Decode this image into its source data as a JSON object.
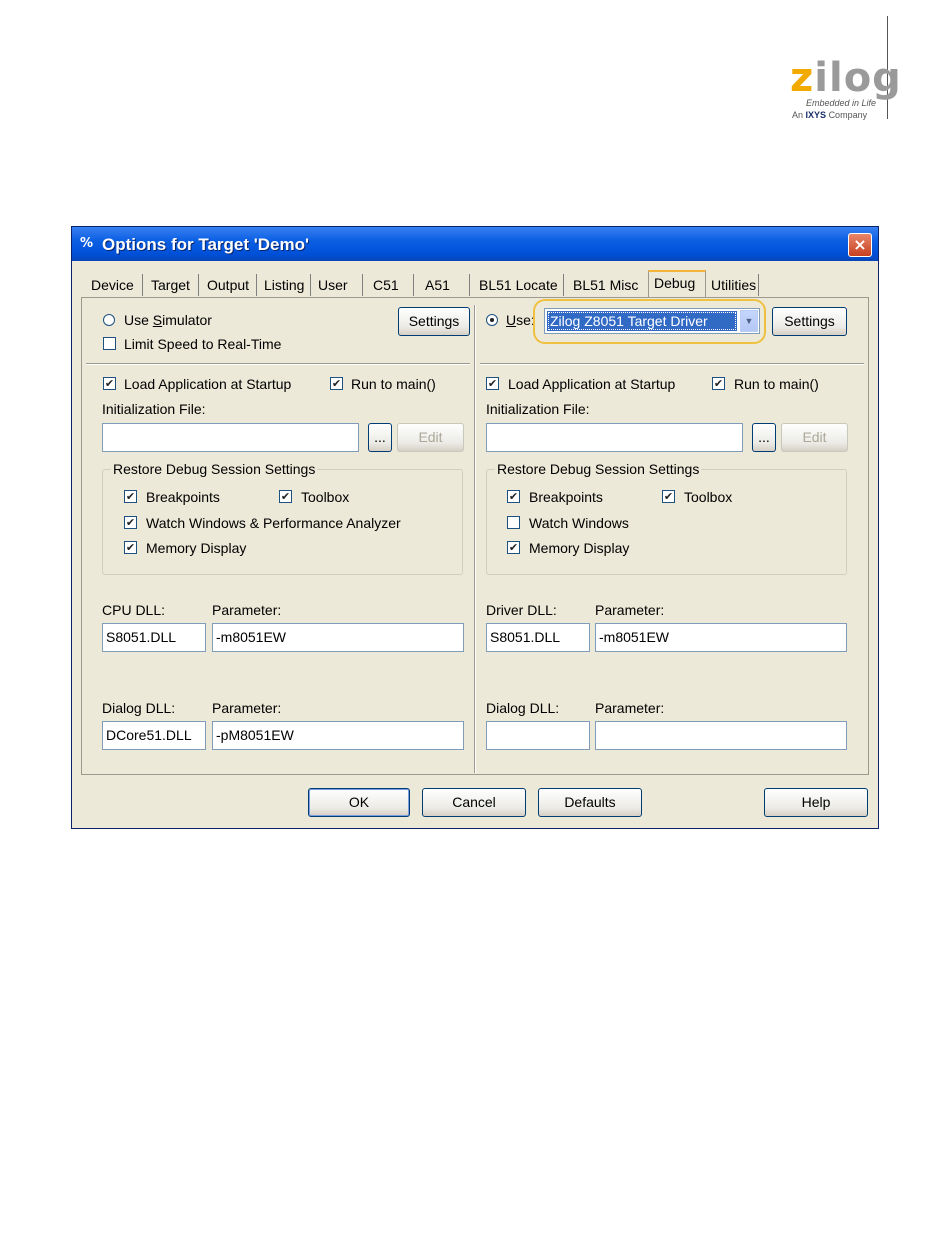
{
  "logo": {
    "brand_z": "z",
    "brand_rest": "ilog",
    "tagline": "Embedded in Life",
    "company_prefix": "An",
    "company_name": "IXYS",
    "company_suffix": "Company"
  },
  "dialog": {
    "title": "Options for Target 'Demo'",
    "close_label": "×",
    "tabs": [
      "Device",
      "Target",
      "Output",
      "Listing",
      "User",
      "C51",
      "A51",
      "BL51 Locate",
      "BL51 Misc",
      "Debug",
      "Utilities"
    ],
    "active_tab": "Debug",
    "left": {
      "use_simulator_pre": "Use ",
      "use_simulator_key": "S",
      "use_simulator_post": "imulator",
      "limit_speed": "Limit Speed to Real-Time",
      "settings": "Settings",
      "load_app": "Load Application at Startup",
      "run_to_main": "Run to main()",
      "init_file_label": "Initialization File:",
      "init_file_value": "",
      "browse": "...",
      "edit": "Edit",
      "restore_group": "Restore Debug Session Settings",
      "breakpoints": "Breakpoints",
      "toolbox": "Toolbox",
      "watch": "Watch Windows & Performance Analyzer",
      "memory": "Memory Display",
      "cpu_dll_label": "CPU DLL:",
      "cpu_param_label": "Parameter:",
      "cpu_dll": "S8051.DLL",
      "cpu_param": "-m8051EW",
      "dialog_dll_label": "Dialog DLL:",
      "dialog_param_label": "Parameter:",
      "dialog_dll": "DCore51.DLL",
      "dialog_param": "-pM8051EW"
    },
    "right": {
      "use_pre": "U",
      "use_post": "se:",
      "driver_selected": "Zilog Z8051 Target Driver",
      "settings": "Settings",
      "load_app": "Load Application at Startup",
      "run_to_main": "Run to main()",
      "init_file_label": "Initialization File:",
      "init_file_value": "",
      "browse": "...",
      "edit": "Edit",
      "restore_group": "Restore Debug Session Settings",
      "breakpoints": "Breakpoints",
      "toolbox": "Toolbox",
      "watch": "Watch Windows",
      "memory": "Memory Display",
      "driver_dll_label": "Driver DLL:",
      "driver_param_label": "Parameter:",
      "driver_dll": "S8051.DLL",
      "driver_param": "-m8051EW",
      "dialog_dll_label": "Dialog DLL:",
      "dialog_param_label": "Parameter:",
      "dialog_dll": "",
      "dialog_param": ""
    },
    "buttons": {
      "ok": "OK",
      "cancel": "Cancel",
      "defaults": "Defaults",
      "help": "Help"
    },
    "check_mark": "✔",
    "colors": {
      "titlebar": "#0a5fe3",
      "highlight": "#f0c040",
      "selection": "#316ac5"
    }
  }
}
